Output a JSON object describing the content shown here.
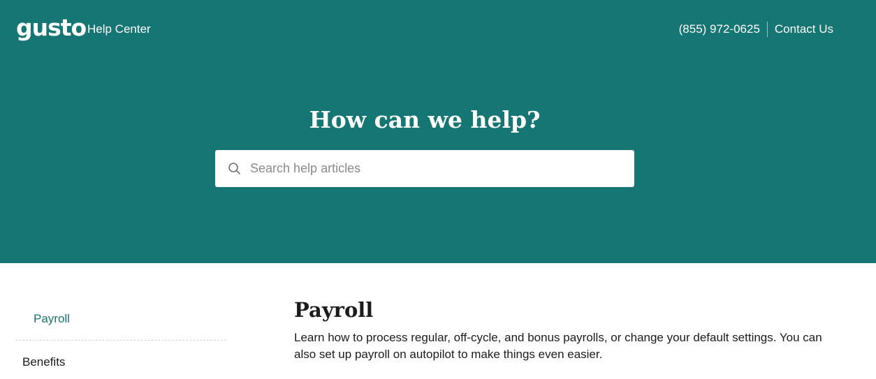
{
  "header": {
    "logo": "gusto",
    "help_center": "Help Center",
    "phone": "(855) 972-0625",
    "contact": "Contact Us"
  },
  "hero": {
    "title": "How can we help?",
    "search_placeholder": "Search help articles",
    "search_value": ""
  },
  "sidebar": {
    "items": [
      {
        "label": "Payroll",
        "active": true
      },
      {
        "label": "Benefits",
        "active": false
      }
    ]
  },
  "main": {
    "title": "Payroll",
    "description": "Learn how to process regular, off-cycle, and bonus payrolls, or change your default settings. You can also set up payroll on autopilot to make things even easier."
  },
  "colors": {
    "brand_teal": "#157673",
    "text": "#1c1c1c",
    "placeholder": "#8a8a8a"
  },
  "icons": [
    "search-icon"
  ]
}
